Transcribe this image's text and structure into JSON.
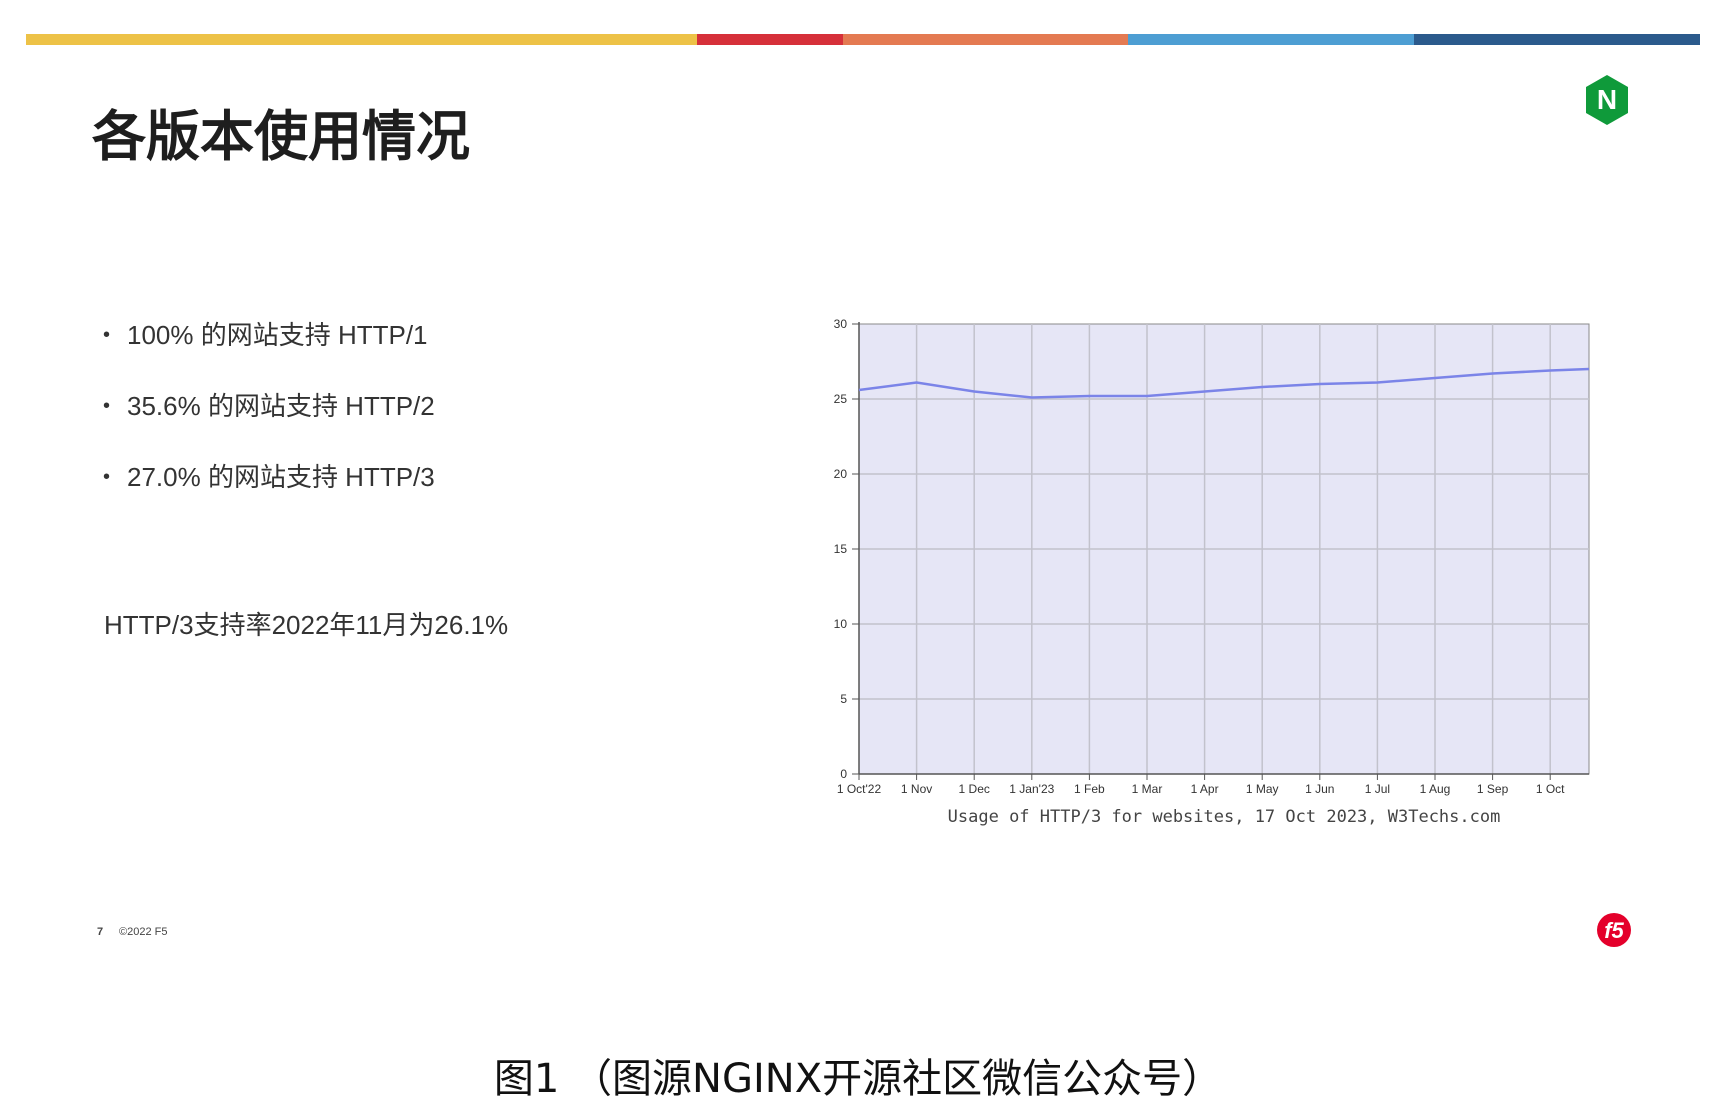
{
  "header": {
    "color_bar": [
      "#EDC247",
      "#D6303A",
      "#E47A52",
      "#4D9ED3",
      "#2B5A8C"
    ],
    "title": "各版本使用情况"
  },
  "bullets": [
    "100% 的网站支持 HTTP/1",
    "35.6% 的网站支持 HTTP/2",
    "27.0% 的网站支持 HTTP/3"
  ],
  "note": "HTTP/3支持率2022年11月为26.1%",
  "chart_data": {
    "type": "line",
    "title": "Usage of HTTP/3 for websites, 17 Oct 2023, W3Techs.com",
    "xlabel": "",
    "ylabel": "",
    "ylim": [
      0,
      30
    ],
    "yticks": [
      0,
      5,
      10,
      15,
      20,
      25,
      30
    ],
    "grid": true,
    "x_tick_labels": [
      "1 Oct'22",
      "1 Nov",
      "1 Dec",
      "1 Jan'23",
      "1 Feb",
      "1 Mar",
      "1 Apr",
      "1 May",
      "1 Jun",
      "1 Jul",
      "1 Aug",
      "1 Sep",
      "1 Oct"
    ],
    "series": [
      {
        "values": [
          25.6,
          26.1,
          25.5,
          25.1,
          25.2,
          25.2,
          25.5,
          25.8,
          26.0,
          26.1,
          26.4,
          26.7,
          26.9,
          27.0
        ],
        "color": "#7B84E8"
      }
    ],
    "plot_background": "#E6E6F6"
  },
  "footer": {
    "page_number": "7",
    "copyright": "©2022 F5"
  },
  "logos": {
    "nginx": {
      "letter": "N",
      "color": "#0F9A3A"
    },
    "f5": {
      "text": "f5",
      "color": "#E4002B"
    }
  },
  "caption": "图1 （图源NGINX开源社区微信公众号）"
}
